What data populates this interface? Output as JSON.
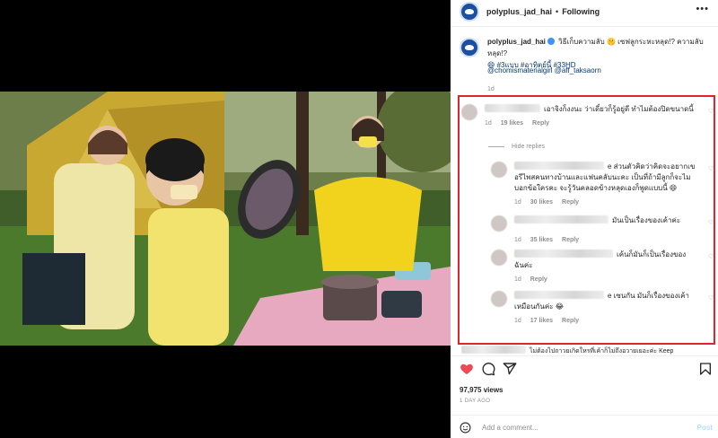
{
  "header": {
    "username": "polyplus_jad_hai",
    "separator": "•",
    "follow_label": "Following",
    "more_icon": "more-horizontal-icon"
  },
  "caption": {
    "username": "polyplus_jad_hai",
    "text": "วิธีเก็บความลับ 🤫 เซฟลูกระหะหลุด!? ความลับหลุด!?",
    "emoji_line": "😄 #3แบบ #อาทิตย์นี้ #33HD",
    "mentions": "@chomismaterialgirl @aff_taksaorn",
    "age": "1d"
  },
  "comments": [
    {
      "text": "เอาจิงก็งงนะ ว่าเดี๋ยวก็รู้อยู่ดี ทำไมต้องปิดขนาดนี้",
      "age": "1d",
      "likes": "19 likes",
      "reply": "Reply"
    }
  ],
  "hide_replies": "Hide replies",
  "replies": [
    {
      "line1": "e ส่วนตัวคิดว่าคิดจะอยากเข",
      "line2": "อรีไพสคนทางบ้านและแฟนคลับนะคะ เป็นที่ถ้ามีลูกก็จะไม",
      "line3": "บอกข้อใครคะ จะรู้วันคลอดข้างหลุดเองก็พูดแบบนี้ 😄",
      "age": "1d",
      "likes": "30 likes",
      "reply": "Reply"
    },
    {
      "line1": "มันเป็นเรื่องของเค้าค่ะ",
      "age": "1d",
      "likes": "35 likes",
      "reply": "Reply"
    },
    {
      "line1": "เค้นก็มันก็เป็นเรื่องของ",
      "line2": "ฉันค่ะ",
      "age": "1d",
      "likes": "",
      "reply": "Reply"
    },
    {
      "line1": "e เซนกัน มันก็เรื่องของเค้า",
      "line2": "เหมือนกันค่ะ 😂",
      "age": "1d",
      "likes": "17 likes",
      "reply": "Reply"
    }
  ],
  "partial_comment": "ไม่ต้องไปถาวยเกิดใหรที่เค้าก็ไม่ถึงอวายเยอะค่ะ Keep",
  "actions": {
    "like_icon": "heart-filled-icon",
    "comment_icon": "comment-icon",
    "share_icon": "share-icon",
    "save_icon": "bookmark-icon",
    "like_color": "#ed4956"
  },
  "views": "97,975 views",
  "posted": "1 DAY AGO",
  "add_comment": {
    "placeholder": "Add a comment...",
    "post_label": "Post"
  },
  "colors": {
    "highlight_box": "#e0252d",
    "link": "#00376b",
    "muted": "#8e8e8e"
  }
}
